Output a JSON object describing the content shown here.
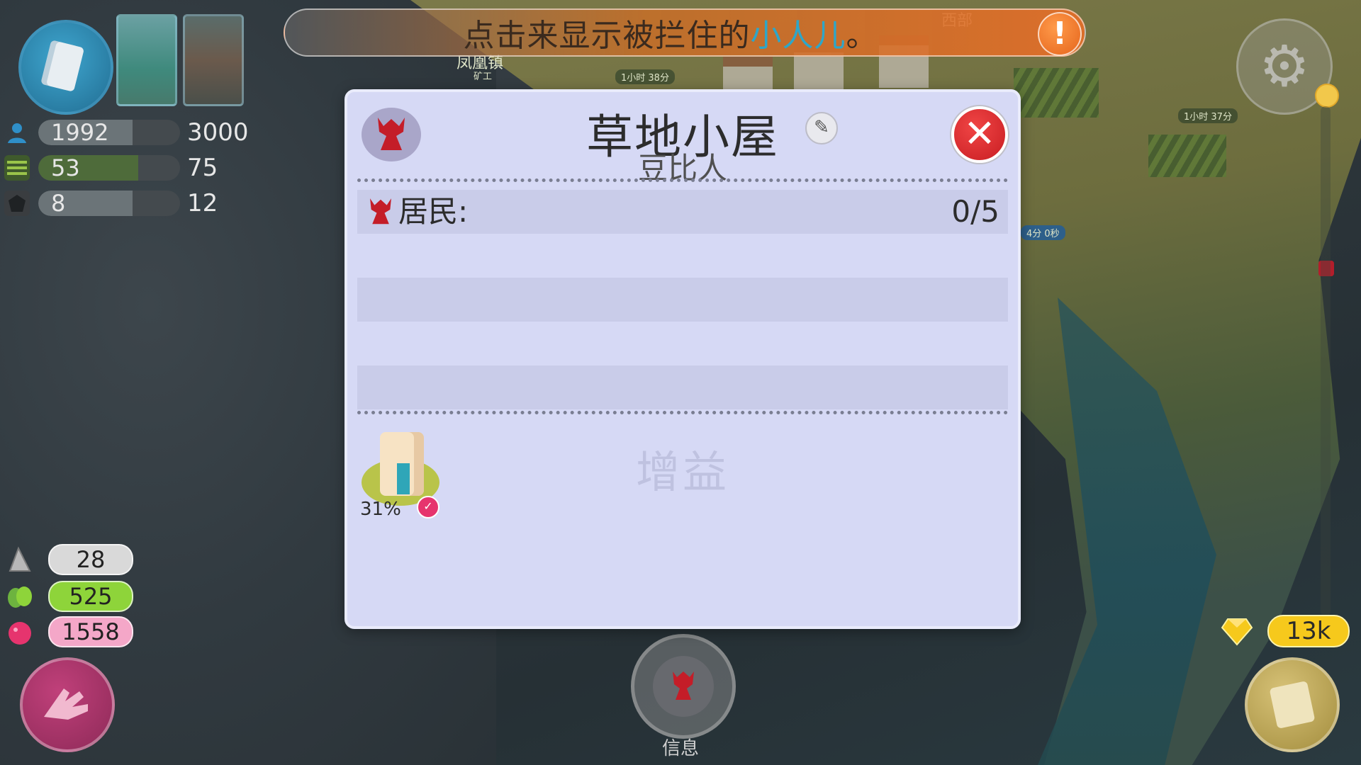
{
  "banner": {
    "text_a": "点击来显示被拦住的",
    "text_b": "小人儿",
    "text_c": "。",
    "alert_glyph": "!"
  },
  "scene_labels": {
    "town_name": "凤凰镇",
    "town_role": "矿工",
    "timer_1": "1小时 38分",
    "timer_2": "1小时 37分",
    "timer_3": "4分 0秒",
    "region": "西部"
  },
  "stats": {
    "population": {
      "value": "1992",
      "max": "3000",
      "fraction": 0.664,
      "icon": "person-icon"
    },
    "food": {
      "value": "53",
      "max": "75",
      "fraction": 0.707,
      "icon": "farm-icon"
    },
    "ore": {
      "value": "8",
      "max": "12",
      "fraction": 0.667,
      "icon": "ore-icon"
    }
  },
  "resources": [
    {
      "name": "stone",
      "value": "28",
      "color": "#d9d9d9",
      "icon": "stone-icon"
    },
    {
      "name": "leaf",
      "value": "525",
      "color": "#8ed43a",
      "icon": "leaf-icon"
    },
    {
      "name": "berry",
      "value": "1558",
      "color": "#f4a7c8",
      "icon": "berry-icon"
    }
  ],
  "gems": {
    "value": "13k",
    "icon": "gem-icon"
  },
  "info_button": {
    "label": "信息"
  },
  "modal": {
    "title": "草地小屋",
    "subtitle": "豆比人",
    "edit_glyph": "✎",
    "close_glyph": "✕",
    "residents_label": "居民:",
    "residents_count": "0/5",
    "buff_title": "增益",
    "buff_progress_text": "31%",
    "buff_progress": 0.31
  },
  "colors": {
    "modal_bg": "#d6d9f5",
    "accent_red": "#c81d22",
    "banner_orange": "#e5651c",
    "gem_gold": "#f6c91c"
  }
}
